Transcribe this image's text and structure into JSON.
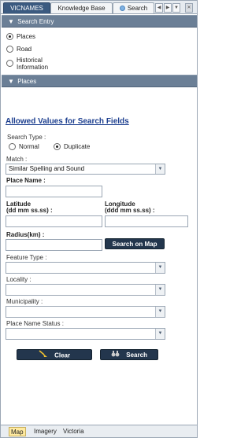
{
  "tabs": {
    "vicnames": "VICNAMES",
    "knowledge_base": "Knowledge Base",
    "search": "Search"
  },
  "search_entry": {
    "header": "Search Entry",
    "options": [
      "Places",
      "Road",
      "Historical Information"
    ],
    "selected": "Places"
  },
  "places": {
    "header": "Places",
    "allowed_values_link": "Allowed Values for Search Fields",
    "search_type_label": "Search Type :",
    "search_type_options": [
      "Normal",
      "Duplicate"
    ],
    "search_type_selected": "Duplicate",
    "match_label": "Match :",
    "match_value": "Similar Spelling and Sound",
    "place_name_label": "Place Name :",
    "latitude_label_line1": "Latitude",
    "latitude_label_line2": "(dd mm ss.ss) :",
    "longitude_label_line1": "Longitude",
    "longitude_label_line2": "(ddd mm ss.ss) :",
    "radius_label": "Radius(km) :",
    "search_on_map_button": "Search on Map",
    "feature_type_label": "Feature Type :",
    "locality_label": "Locality :",
    "municipality_label": "Municipality :",
    "place_name_status_label": "Place Name Status :",
    "clear_button": "Clear",
    "search_button": "Search"
  },
  "bottom_tabs": {
    "map": "Map",
    "imagery": "Imagery",
    "victoria": "Victoria",
    "active": "Map"
  },
  "colors": {
    "section_header": "#6b7f96",
    "active_tab": "#3b5a80",
    "dark_button": "#23364d",
    "link": "#1d3f8f",
    "map_tab_highlight": "#ffeaa0"
  }
}
